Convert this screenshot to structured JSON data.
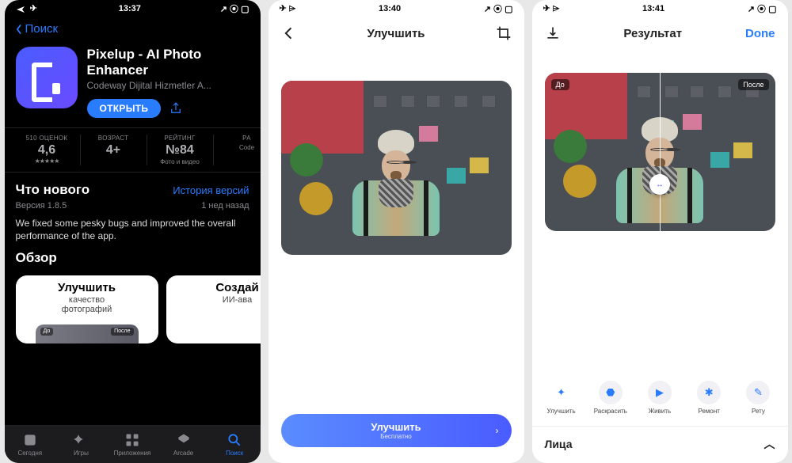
{
  "screen1": {
    "status": {
      "time": "13:37"
    },
    "back": "Поиск",
    "app": {
      "title": "Pixelup - AI Photo Enhancer",
      "dev": "Codeway Dijital Hizmetler A...",
      "open": "ОТКРЫТЬ"
    },
    "metrics": {
      "m1": {
        "label": "510 ОЦЕНОК",
        "value": "4,6",
        "stars": "★★★★★"
      },
      "m2": {
        "label": "ВОЗРАСТ",
        "value": "4+",
        "sub": ""
      },
      "m3": {
        "label": "РЕЙТИНГ",
        "value": "№84",
        "sub": "Фото и видео"
      },
      "m4": {
        "label": "РА",
        "value": "",
        "sub": "Code"
      }
    },
    "whatsnew": {
      "title": "Что нового",
      "history": "История версий",
      "version": "Версия 1.8.5",
      "ago": "1 нед назад",
      "text": "We fixed some pesky bugs and improved the overall performance of the app."
    },
    "obzor": "Обзор",
    "card1": {
      "title": "Улучшить",
      "sub1": "качество",
      "sub2": "фотографий",
      "before": "До",
      "after": "После"
    },
    "card2": {
      "title": "Создай",
      "sub1": "ИИ-ава"
    },
    "tabs": {
      "t1": "Сегодня",
      "t2": "Игры",
      "t3": "Приложения",
      "t4": "Arcade",
      "t5": "Поиск"
    }
  },
  "screen2": {
    "status": {
      "time": "13:40"
    },
    "title": "Улучшить",
    "cta": {
      "title": "Улучшить",
      "sub": "Бесплатно"
    }
  },
  "screen3": {
    "status": {
      "time": "13:41"
    },
    "title": "Результат",
    "done": "Done",
    "before": "До",
    "after": "После",
    "actions": {
      "a1": "Улучшить",
      "a2": "Раскрасить",
      "a3": "Живить",
      "a4": "Ремонт",
      "a5": "Рету"
    },
    "faces": "Лица"
  }
}
